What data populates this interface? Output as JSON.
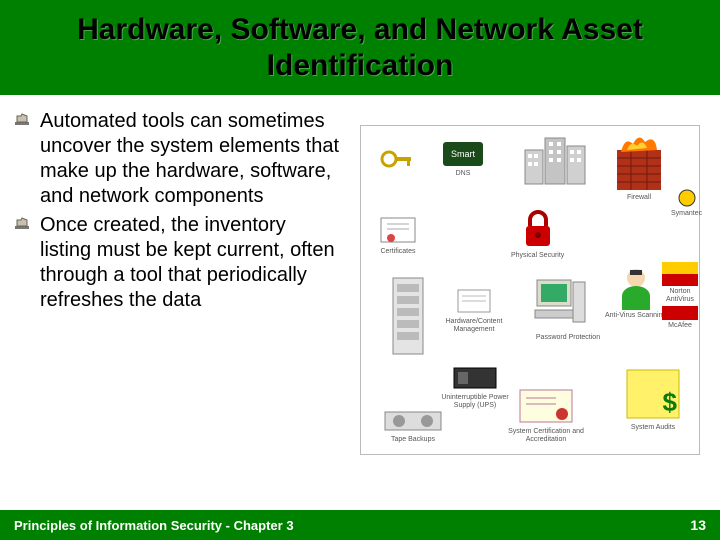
{
  "title": "Hardware, Software, and Network Asset Identification",
  "bullets": [
    "Automated tools can sometimes uncover the system elements that make up the hardware, software, and network components",
    "Once created, the inventory listing must be kept current, often through a tool that periodically refreshes the data"
  ],
  "diagram": {
    "items": {
      "key": "",
      "smart": "Smart",
      "dns": "DNS",
      "certificates": "Certificates",
      "physical": "Physical Security",
      "firewall": "Firewall",
      "symantec": "Symantec",
      "hcm": "Hardware/Content Management",
      "vscan": "Anti-Virus Scanning",
      "pwd": "Password Protection",
      "norton": "Norton AntiVirus",
      "mcafee": "McAfee",
      "ups": "Uninterruptible Power Supply (UPS)",
      "backups": "Tape Backups",
      "cert_accr": "System Certification and Accreditation",
      "audits": "System Audits",
      "dollar": "$"
    }
  },
  "footer": {
    "left": "Principles of Information Security - Chapter 3",
    "page": "13"
  }
}
